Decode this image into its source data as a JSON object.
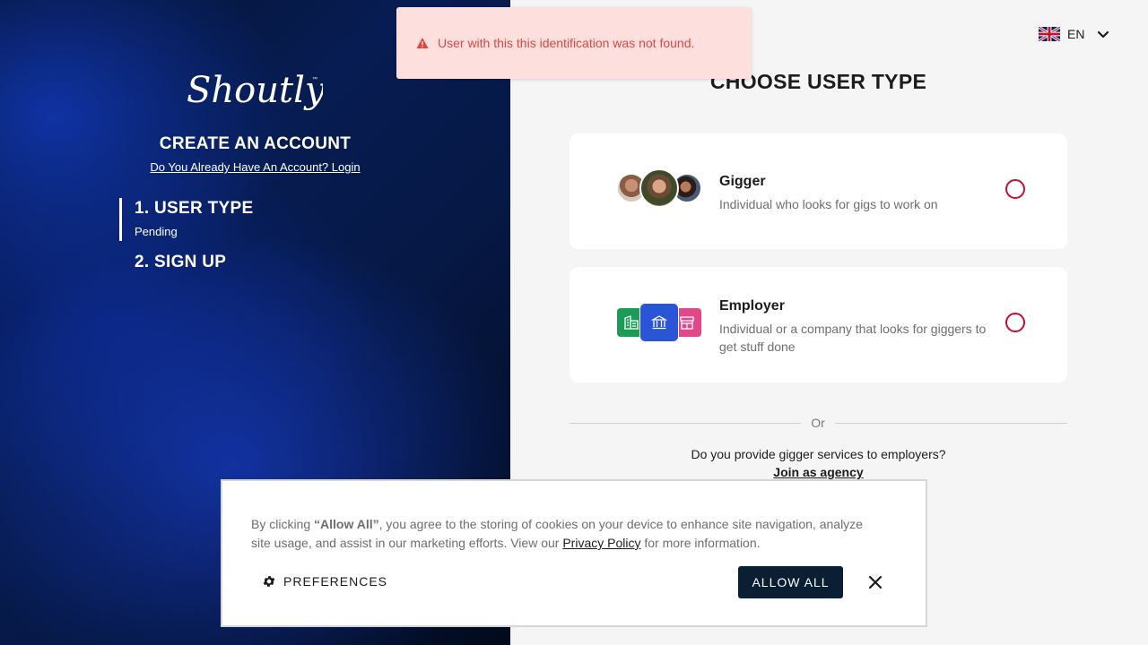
{
  "brand": {
    "logo_text": "Shoutly"
  },
  "left": {
    "create_title": "CREATE AN ACCOUNT",
    "login_link": "Do You Already Have An Account? Login",
    "steps": [
      {
        "title": "1. USER TYPE",
        "status": "Pending"
      },
      {
        "title": "2. SIGN UP"
      }
    ]
  },
  "language": {
    "code": "EN",
    "flag_icon": "uk-flag-icon"
  },
  "main": {
    "title": "CHOOSE USER TYPE",
    "options": [
      {
        "title": "Gigger",
        "description": "Individual who looks for gigs to work on",
        "selected": false
      },
      {
        "title": "Employer",
        "description": "Individual or a company that looks for giggers to get stuff done",
        "selected": false
      }
    ],
    "divider_text": "Or",
    "agency_question": "Do you provide gigger services to employers?",
    "agency_link": "Join as agency"
  },
  "toast": {
    "message": "User with this this identification was not found.",
    "icon": "warning-icon"
  },
  "cookie": {
    "text_before": "By clicking ",
    "bold": "“Allow All”",
    "text_middle": ", you agree to the storing of cookies on your device to enhance site navigation, analyze site usage, and assist in our marketing efforts. View our ",
    "privacy_link": "Privacy Policy",
    "text_after": " for more information.",
    "preferences_label": "PREFERENCES",
    "allow_all_label": "ALLOW ALL"
  },
  "colors": {
    "accent_red": "#c8102e",
    "error_bg": "#fde0de",
    "error_text": "#e0463d",
    "button_dark": "#0a1f33",
    "employer_green": "#1b9a58",
    "employer_blue": "#2a55d6",
    "employer_pink": "#e0488a"
  }
}
